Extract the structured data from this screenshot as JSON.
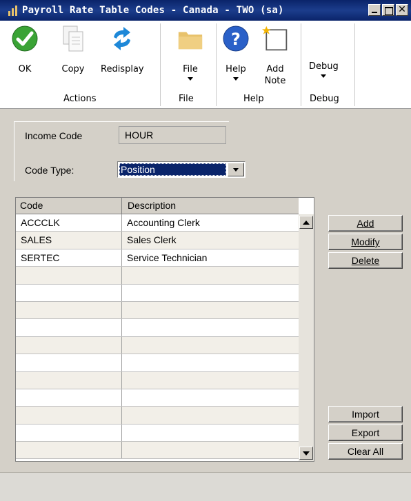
{
  "window": {
    "title": "Payroll Rate Table Codes - Canada - TWO (sa)",
    "close_glyph": "✕"
  },
  "ribbon": {
    "buttons": {
      "ok": "OK",
      "copy": "Copy",
      "redisplay": "Redisplay",
      "file": "File",
      "help": "Help",
      "add_note_line1": "Add",
      "add_note_line2": "Note",
      "debug": "Debug"
    },
    "groups": {
      "actions": "Actions",
      "file": "File",
      "help": "Help",
      "debug": "Debug"
    },
    "icons": [
      "checkmark-icon",
      "copy-icon",
      "refresh-icon",
      "folder-icon",
      "help-icon",
      "note-icon"
    ],
    "colors": {
      "ok_green": "#3aa335",
      "help_blue": "#2a60c8",
      "redisplay_blue": "#1e88d8",
      "folder": "#e8c26b"
    }
  },
  "form": {
    "income_code_label": "Income Code",
    "income_code_value": "HOUR",
    "code_type_label": "Code Type:",
    "code_type_value": "Position"
  },
  "grid": {
    "headers": {
      "code": "Code",
      "description": "Description"
    },
    "rows": [
      {
        "code": "ACCCLK",
        "description": "Accounting Clerk"
      },
      {
        "code": "SALES",
        "description": "Sales Clerk"
      },
      {
        "code": "SERTEC",
        "description": "Service Technician"
      },
      {
        "code": "",
        "description": ""
      },
      {
        "code": "",
        "description": ""
      },
      {
        "code": "",
        "description": ""
      },
      {
        "code": "",
        "description": ""
      },
      {
        "code": "",
        "description": ""
      },
      {
        "code": "",
        "description": ""
      },
      {
        "code": "",
        "description": ""
      },
      {
        "code": "",
        "description": ""
      },
      {
        "code": "",
        "description": ""
      },
      {
        "code": "",
        "description": ""
      },
      {
        "code": "",
        "description": ""
      }
    ]
  },
  "side_buttons": {
    "add": "Add",
    "modify": "Modify",
    "delete": "Delete",
    "import": "Import",
    "export": "Export",
    "clear_all": "Clear All"
  }
}
